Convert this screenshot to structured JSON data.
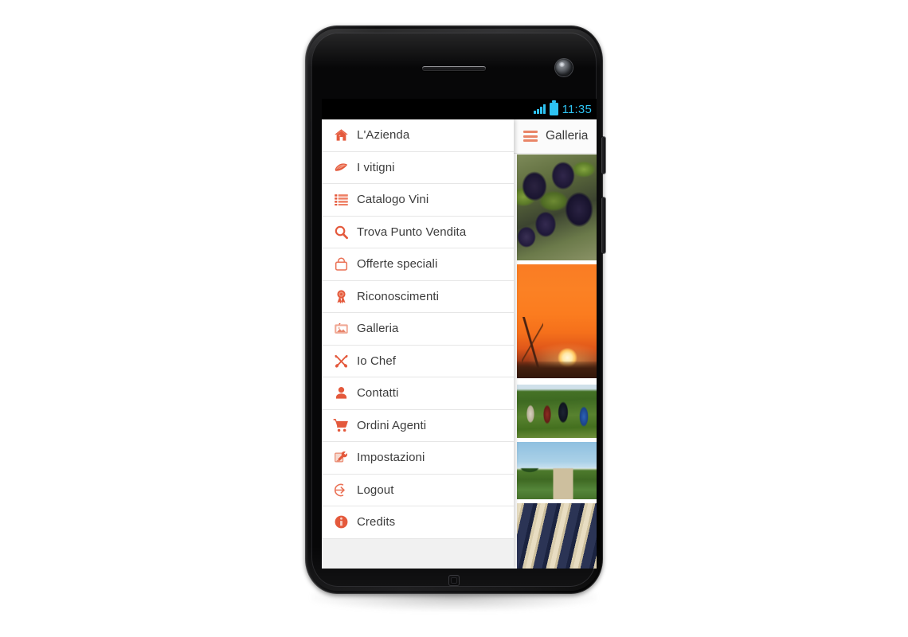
{
  "device": {
    "kind": "android-smartphone",
    "status_bar": {
      "signal_icon": "signal-bars-icon",
      "battery_icon": "battery-full-icon",
      "time": "11:35",
      "accent_color": "#2ec3f2"
    },
    "hardware": {
      "speaker": "earpiece-speaker",
      "front_camera": "front-camera-icon",
      "home_indicator": "home-logo-dimple",
      "power_button": "power-button",
      "volume_button": "volume-button"
    }
  },
  "app": {
    "accent_color": "#e1583c",
    "accent_light_color": "#e98567",
    "action_bar": {
      "menu_icon": "hamburger-menu-icon",
      "title": "Galleria"
    },
    "drawer": {
      "items": [
        {
          "id": "lazienda",
          "label": "L'Azienda",
          "icon": "home-icon"
        },
        {
          "id": "vitigni",
          "label": "I vitigni",
          "icon": "leaf-icon"
        },
        {
          "id": "catalogo",
          "label": "Catalogo Vini",
          "icon": "list-icon"
        },
        {
          "id": "punto",
          "label": "Trova Punto Vendita",
          "icon": "search-icon"
        },
        {
          "id": "offerte",
          "label": "Offerte speciali",
          "icon": "shopping-bag-icon"
        },
        {
          "id": "premi",
          "label": "Riconoscimenti",
          "icon": "award-ribbon-icon"
        },
        {
          "id": "galleria",
          "label": "Galleria",
          "icon": "photo-icon"
        },
        {
          "id": "chef",
          "label": "Io Chef",
          "icon": "fork-spoon-icon"
        },
        {
          "id": "contatti",
          "label": "Contatti",
          "icon": "person-icon"
        },
        {
          "id": "ordini",
          "label": "Ordini Agenti",
          "icon": "shopping-cart-icon"
        },
        {
          "id": "impostaz",
          "label": "Impostazioni",
          "icon": "settings-tools-icon"
        },
        {
          "id": "logout",
          "label": "Logout",
          "icon": "logout-arrow-icon"
        },
        {
          "id": "credits",
          "label": "Credits",
          "icon": "info-circle-icon"
        }
      ]
    },
    "gallery": {
      "photos": [
        {
          "id": "photo-grapes",
          "alt": "Grappoli di uva nera sulla vite"
        },
        {
          "id": "photo-sunset",
          "alt": "Tramonto arancione sul vigneto"
        },
        {
          "id": "photo-harvest",
          "alt": "Vendemmiatori tra i filari"
        },
        {
          "id": "photo-vineyard",
          "alt": "Vigneto con casale"
        },
        {
          "id": "photo-crates",
          "alt": "Cassette di uva impilate"
        }
      ]
    }
  }
}
